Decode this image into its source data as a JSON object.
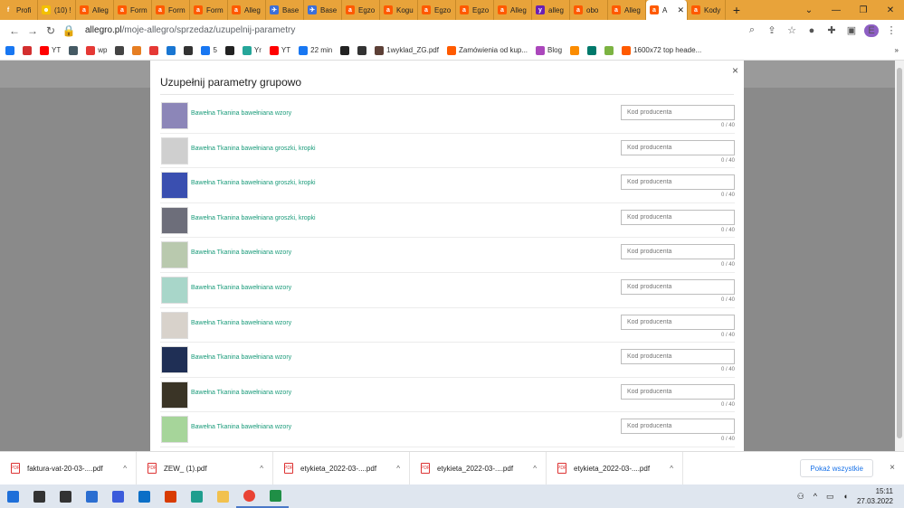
{
  "browser": {
    "tabs": [
      {
        "label": "Profi",
        "color": "#e8a33a",
        "glyph": "f"
      },
      {
        "label": "(10) !",
        "color": "#f3c000",
        "glyph": "☻"
      },
      {
        "label": "Alleg",
        "color": "#ff5a00",
        "glyph": "a"
      },
      {
        "label": "Form",
        "color": "#ff5a00",
        "glyph": "a"
      },
      {
        "label": "Form",
        "color": "#ff5a00",
        "glyph": "a"
      },
      {
        "label": "Form",
        "color": "#ff5a00",
        "glyph": "a"
      },
      {
        "label": "Alleg",
        "color": "#ff5a00",
        "glyph": "a"
      },
      {
        "label": "Base",
        "color": "#3d6fd8",
        "glyph": "✈"
      },
      {
        "label": "Base",
        "color": "#3d6fd8",
        "glyph": "✈"
      },
      {
        "label": "Egzo",
        "color": "#ff5a00",
        "glyph": "a"
      },
      {
        "label": "Kogu",
        "color": "#ff5a00",
        "glyph": "a"
      },
      {
        "label": "Egzo",
        "color": "#ff5a00",
        "glyph": "a"
      },
      {
        "label": "Egzo",
        "color": "#ff5a00",
        "glyph": "a"
      },
      {
        "label": "Alleg",
        "color": "#ff5a00",
        "glyph": "a"
      },
      {
        "label": "alleg",
        "color": "#6a1fb3",
        "glyph": "y"
      },
      {
        "label": "obo",
        "color": "#ff5a00",
        "glyph": "a"
      },
      {
        "label": "Alleg",
        "color": "#ff5a00",
        "glyph": "a"
      },
      {
        "label": "A",
        "color": "#ff5a00",
        "glyph": "a",
        "active": true
      },
      {
        "label": "Kody",
        "color": "#ff5a00",
        "glyph": "a"
      }
    ],
    "new_tab": "+",
    "url_host": "allegro.pl",
    "url_path": "/moje-allegro/sprzedaz/uzupelnij-parametry",
    "bookmarks": [
      {
        "label": "",
        "color": "#1877f2"
      },
      {
        "label": "",
        "color": "#d32f2f"
      },
      {
        "label": "YT",
        "color": "#ff0000"
      },
      {
        "label": "",
        "color": "#455a64"
      },
      {
        "label": "wp",
        "color": "#e53935"
      },
      {
        "label": "",
        "color": "#444"
      },
      {
        "label": "",
        "color": "#e67e22"
      },
      {
        "label": "",
        "color": "#e53935"
      },
      {
        "label": "",
        "color": "#1976d2"
      },
      {
        "label": "",
        "color": "#333"
      },
      {
        "label": "5",
        "color": "#1877f2"
      },
      {
        "label": "",
        "color": "#222"
      },
      {
        "label": "Yr",
        "color": "#26a69a"
      },
      {
        "label": "YT",
        "color": "#ff0000"
      },
      {
        "label": "22 min",
        "color": "#1877f2"
      },
      {
        "label": "",
        "color": "#222"
      },
      {
        "label": "",
        "color": "#333"
      },
      {
        "label": "1wyklad_ZG.pdf",
        "color": "#5d4037"
      },
      {
        "label": "Zamówienia od kup...",
        "color": "#ff5a00"
      },
      {
        "label": "Blog",
        "color": "#ab47bc"
      },
      {
        "label": "",
        "color": "#fb8c00"
      },
      {
        "label": "",
        "color": "#00796b"
      },
      {
        "label": "",
        "color": "#7cb342"
      },
      {
        "label": "1600x72 top heade...",
        "color": "#ff5a00"
      }
    ]
  },
  "modal": {
    "title": "Uzupełnij parametry grupowo",
    "close": "×",
    "items": [
      {
        "name": "Bawełna Tkanina bawełniana wzory",
        "placeholder": "Kod producenta",
        "counter": "0 / 40",
        "swatch": "#8c86b8"
      },
      {
        "name": "Bawełna Tkanina bawełniana groszki, kropki",
        "placeholder": "Kod producenta",
        "counter": "0 / 40",
        "swatch": "#cfcfcf"
      },
      {
        "name": "Bawełna Tkanina bawełniana groszki, kropki",
        "placeholder": "Kod producenta",
        "counter": "0 / 40",
        "swatch": "#3a4fb0"
      },
      {
        "name": "Bawełna Tkanina bawełniana groszki, kropki",
        "placeholder": "Kod producenta",
        "counter": "0 / 40",
        "swatch": "#6d6e7a"
      },
      {
        "name": "Bawełna Tkanina bawełniana wzory",
        "placeholder": "Kod producenta",
        "counter": "0 / 40",
        "swatch": "#b9c9ae"
      },
      {
        "name": "Bawełna Tkanina bawełniana wzory",
        "placeholder": "Kod producenta",
        "counter": "0 / 40",
        "swatch": "#a8d6c9"
      },
      {
        "name": "Bawełna Tkanina bawełniana wzory",
        "placeholder": "Kod producenta",
        "counter": "0 / 40",
        "swatch": "#d8d2cb"
      },
      {
        "name": "Bawełna Tkanina bawełniana wzory",
        "placeholder": "Kod producenta",
        "counter": "0 / 40",
        "swatch": "#1f2f55"
      },
      {
        "name": "Bawełna Tkanina bawełniana wzory",
        "placeholder": "Kod producenta",
        "counter": "0 / 40",
        "swatch": "#3a3426"
      },
      {
        "name": "Bawełna Tkanina bawełniana wzory",
        "placeholder": "Kod producenta",
        "counter": "0 / 40",
        "swatch": "#a6d59a"
      }
    ]
  },
  "downloads": {
    "files": [
      {
        "label": "faktura-vat-20-03-....pdf"
      },
      {
        "label": "ZEW_ (1).pdf"
      },
      {
        "label": "etykieta_2022-03-....pdf"
      },
      {
        "label": "etykieta_2022-03-....pdf"
      },
      {
        "label": "etykieta_2022-03-....pdf"
      }
    ],
    "show_all": "Pokaż wszystkie",
    "close": "×"
  },
  "taskbar": {
    "time": "15:11",
    "date": "27.03.2022",
    "apps": [
      {
        "name": "start",
        "color": "#1e6fd9"
      },
      {
        "name": "search",
        "color": "#333"
      },
      {
        "name": "task-view",
        "color": "#333"
      },
      {
        "name": "store",
        "color": "#2b6ed1"
      },
      {
        "name": "app-m",
        "color": "#3b5bdb"
      },
      {
        "name": "mail",
        "color": "#0b6fc7"
      },
      {
        "name": "office",
        "color": "#d83b01"
      },
      {
        "name": "edge",
        "color": "#1f9e8e"
      },
      {
        "name": "explorer",
        "color": "#f2c14e"
      },
      {
        "name": "chrome",
        "color": "#e94335",
        "active": true
      },
      {
        "name": "sheets",
        "color": "#1f8f46",
        "active": true
      }
    ]
  }
}
